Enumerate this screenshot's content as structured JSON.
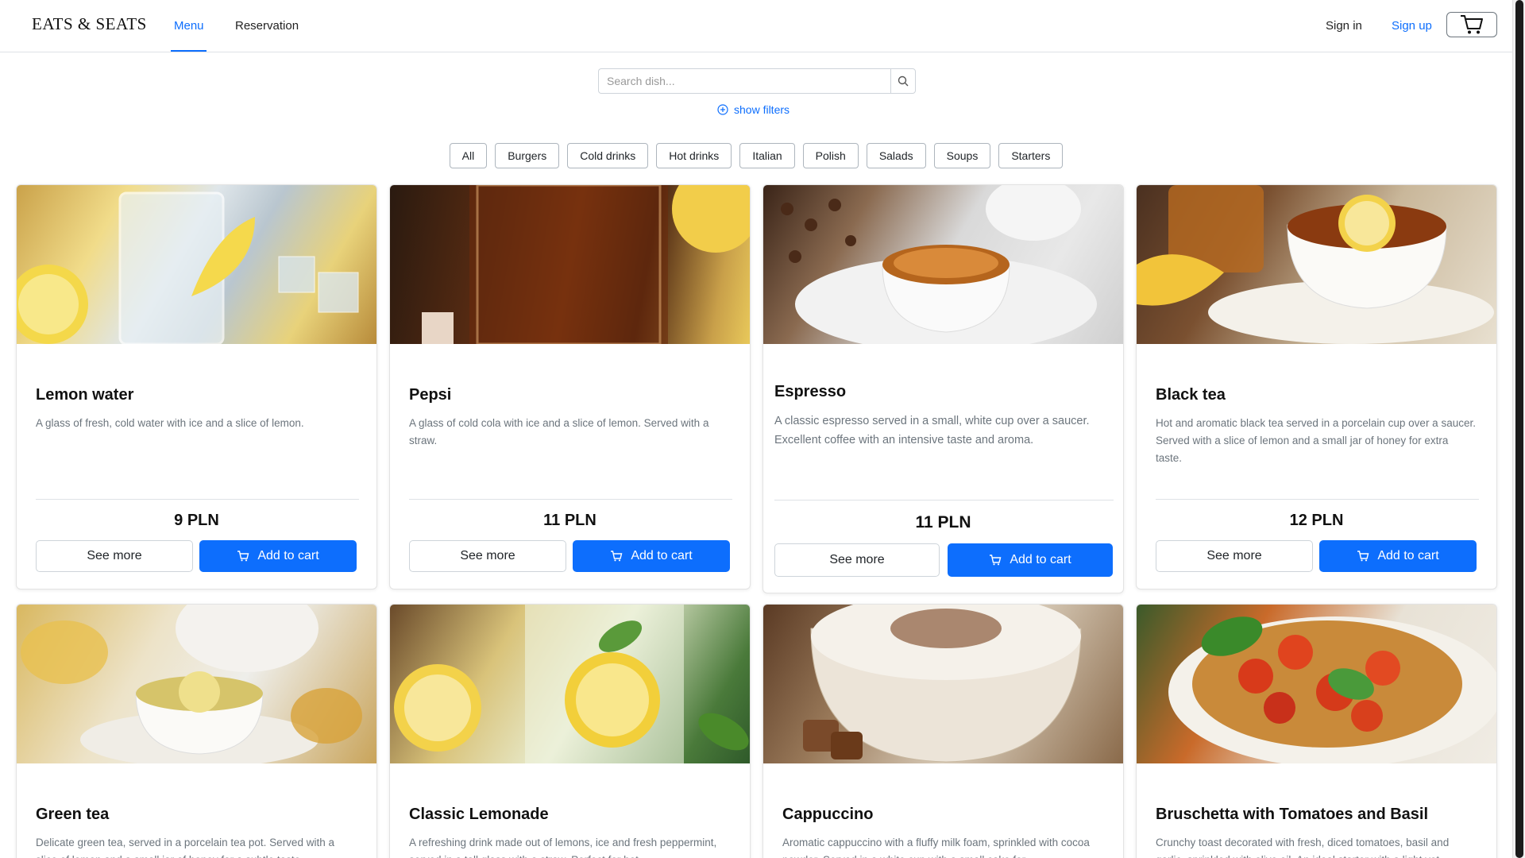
{
  "brand": "EATS & SEATS",
  "nav": {
    "menu": "Menu",
    "reservation": "Reservation",
    "sign_in": "Sign in",
    "sign_up": "Sign up"
  },
  "search": {
    "placeholder": "Search dish...",
    "value": ""
  },
  "filters_toggle": "show filters",
  "categories": [
    "All",
    "Burgers",
    "Cold drinks",
    "Hot drinks",
    "Italian",
    "Polish",
    "Salads",
    "Soups",
    "Starters"
  ],
  "buttons": {
    "see_more": "See more",
    "add_to_cart": "Add to cart"
  },
  "dishes": [
    {
      "name": "Lemon water",
      "description": "A glass of fresh, cold water with ice and a slice of lemon.",
      "price": "9 PLN"
    },
    {
      "name": "Pepsi",
      "description": "A glass of cold cola with ice and a slice of lemon. Served with a straw.",
      "price": "11 PLN"
    },
    {
      "name": "Espresso",
      "description": "A classic espresso served in a small, white cup over a saucer. Excellent coffee with an intensive taste and aroma.",
      "price": "11 PLN"
    },
    {
      "name": "Black tea",
      "description": "Hot and aromatic black tea served in a porcelain cup over a saucer. Served with a slice of lemon and a small jar of honey for extra taste.",
      "price": "12 PLN"
    },
    {
      "name": "Green tea",
      "description": "Delicate green tea, served in a porcelain tea pot. Served with a slice of lemon and a small jar of honey for a subtle taste."
    },
    {
      "name": "Classic Lemonade",
      "description": "A refreshing drink made out of lemons, ice and fresh peppermint, served in a tall glass with a straw. Perfect for hot"
    },
    {
      "name": "Cappuccino",
      "description": "Aromatic cappuccino with a fluffy milk foam, sprinkled with cocoa powder. Served in a white cup with a small cake for"
    },
    {
      "name": "Bruschetta with Tomatoes and Basil",
      "description": "Crunchy toast decorated with fresh, diced tomatoes, basil and garlic, sprinkled with olive oil. An ideal starter with a light yet"
    }
  ],
  "colors": {
    "accent": "#0d6efd",
    "border": "#dee2e6",
    "muted_text": "#6c757d"
  }
}
